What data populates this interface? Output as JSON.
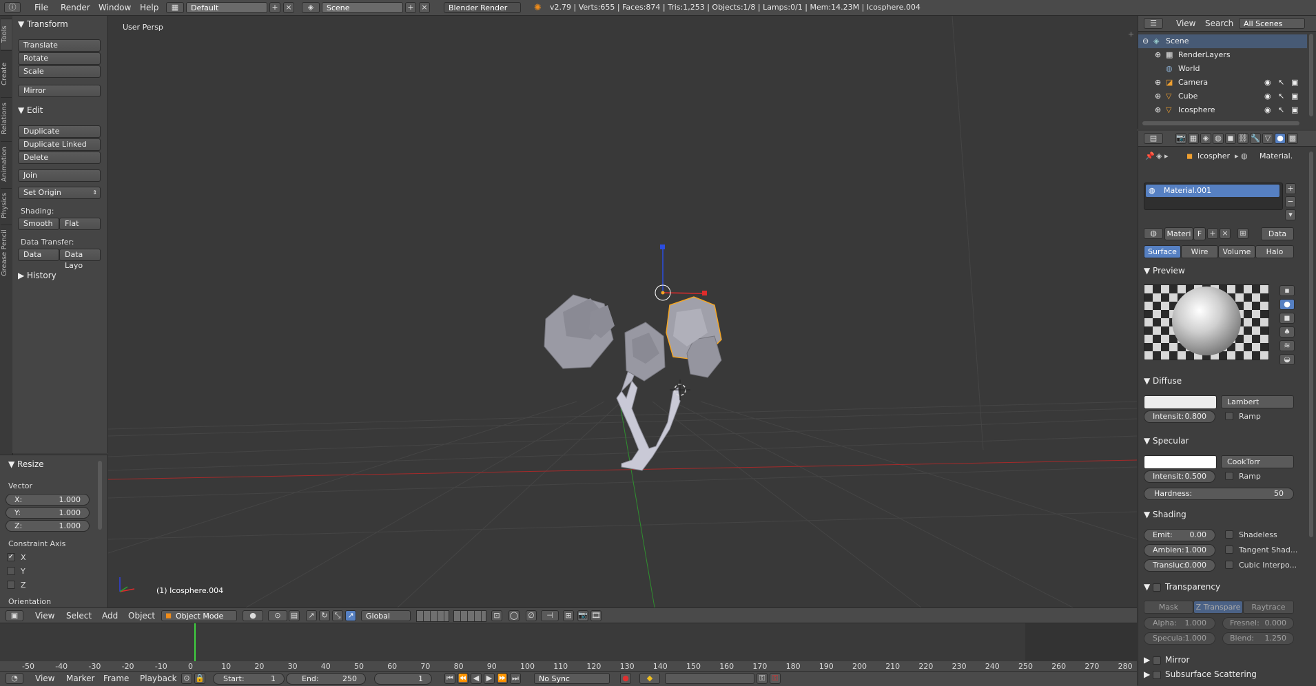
{
  "topbar": {
    "menus": [
      "File",
      "Render",
      "Window",
      "Help"
    ],
    "layout": "Default",
    "scene": "Scene",
    "engine": "Blender Render",
    "stats": "v2.79 | Verts:655 | Faces:874 | Tris:1,253 | Objects:1/8 | Lamps:0/1 | Mem:14.23M | Icosphere.004"
  },
  "tabs": [
    "Tools",
    "Create",
    "Relations",
    "Animation",
    "Physics",
    "Grease Pencil"
  ],
  "shelf": {
    "transform_title": "Transform",
    "transform_buttons": [
      "Translate",
      "Rotate",
      "Scale"
    ],
    "mirror": "Mirror",
    "edit_title": "Edit",
    "edit_buttons": [
      "Duplicate",
      "Duplicate Linked",
      "Delete"
    ],
    "join": "Join",
    "set_origin": "Set Origin",
    "shading_label": "Shading:",
    "smooth": "Smooth",
    "flat": "Flat",
    "data_transfer_label": "Data Transfer:",
    "data": "Data",
    "data_layout": "Data Layo",
    "history_title": "History"
  },
  "redo": {
    "title": "Resize",
    "vector_label": "Vector",
    "x_label": "X:",
    "x_value": "1.000",
    "y_label": "Y:",
    "y_value": "1.000",
    "z_label": "Z:",
    "z_value": "1.000",
    "constraint_label": "Constraint Axis",
    "axis_x": "X",
    "axis_y": "Y",
    "axis_z": "Z",
    "orientation_label": "Orientation"
  },
  "viewport": {
    "view_name": "User Persp",
    "object_name": "(1) Icosphere.004",
    "axis_x": "x",
    "axis_y": "y",
    "axis_z": "z"
  },
  "vheader": {
    "menus": [
      "View",
      "Select",
      "Add",
      "Object"
    ],
    "mode": "Object Mode",
    "orientation": "Global"
  },
  "timeline": {
    "ticks": [
      "-50",
      "-40",
      "-30",
      "-20",
      "-10",
      "0",
      "10",
      "20",
      "30",
      "40",
      "50",
      "60",
      "70",
      "80",
      "90",
      "100",
      "110",
      "120",
      "130",
      "140",
      "150",
      "160",
      "170",
      "180",
      "190",
      "200",
      "210",
      "220",
      "230",
      "240",
      "250",
      "260",
      "270",
      "280"
    ],
    "menus": [
      "View",
      "Marker",
      "Frame",
      "Playback"
    ],
    "start_label": "Start:",
    "start_value": "1",
    "end_label": "End:",
    "end_value": "250",
    "current_frame": "1",
    "sync": "No Sync"
  },
  "outliner": {
    "menus": [
      "View",
      "Search"
    ],
    "filter": "All Scenes",
    "items": [
      "Scene",
      "RenderLayers",
      "World",
      "Camera",
      "Cube",
      "Icosphere"
    ]
  },
  "props": {
    "breadcrumb_object": "Icospher",
    "breadcrumb_material": "Material.",
    "slot_name": "Material.001",
    "material_name": "Materi",
    "material_f": "F",
    "data_dropdown": "Data",
    "tabs": [
      "Surface",
      "Wire",
      "Volume",
      "Halo"
    ],
    "preview_title": "Preview",
    "diffuse_title": "Diffuse",
    "diffuse_shader": "Lambert",
    "diffuse_intensity_label": "Intensit:",
    "diffuse_intensity": "0.800",
    "ramp": "Ramp",
    "specular_title": "Specular",
    "specular_shader": "CookTorr",
    "specular_intensity_label": "Intensit:",
    "specular_intensity": "0.500",
    "hardness_label": "Hardness:",
    "hardness": "50",
    "shading_title": "Shading",
    "emit_label": "Emit:",
    "emit": "0.00",
    "ambient_label": "Ambien:",
    "ambient": "1.000",
    "transluc_label": "Transluc:",
    "transluc": "0.000",
    "shadeless": "Shadeless",
    "tangent": "Tangent Shad...",
    "cubic": "Cubic Interpo...",
    "transparency_title": "Transparency",
    "trans_tabs": [
      "Mask",
      "Z Transpare",
      "Raytrace"
    ],
    "alpha_label": "Alpha:",
    "alpha": "1.000",
    "fresnel_label": "Fresnel:",
    "fresnel": "0.000",
    "specula_label": "Specula:",
    "specula": "1.000",
    "blend_label": "Blend:",
    "blend": "1.250",
    "mirror_title": "Mirror",
    "sss_title": "Subsurface Scattering"
  },
  "colors": {
    "selection": "#5680c2",
    "active_outline": "#f5a623",
    "x_axis": "#a52a2a",
    "y_axis": "#2f8f2f",
    "current_frame": "#3fd13f"
  }
}
